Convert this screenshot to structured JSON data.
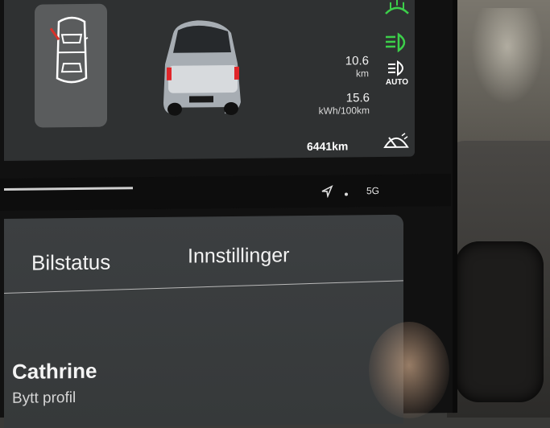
{
  "vehicle": {
    "range_value": "10.6",
    "range_unit": "km",
    "consumption_value": "15.6",
    "consumption_unit": "kWh/100km",
    "odometer": "6441km",
    "auto_label": "AUTO"
  },
  "status_bar": {
    "signal": "5G"
  },
  "tabs": [
    {
      "label": "Bilstatus"
    },
    {
      "label": "Innstillinger"
    }
  ],
  "profile": {
    "name": "Cathrine",
    "switch_label": "Bytt profil"
  },
  "colors": {
    "indicator_green": "#3ccf4a",
    "door_open_red": "#d9322a",
    "tail_light_red": "#e0262a"
  },
  "icons": [
    "car-doors-icon",
    "defrost-icon",
    "headlight-icon",
    "auto-headlight-icon",
    "wiper-icon",
    "navigation-arrow-icon"
  ]
}
